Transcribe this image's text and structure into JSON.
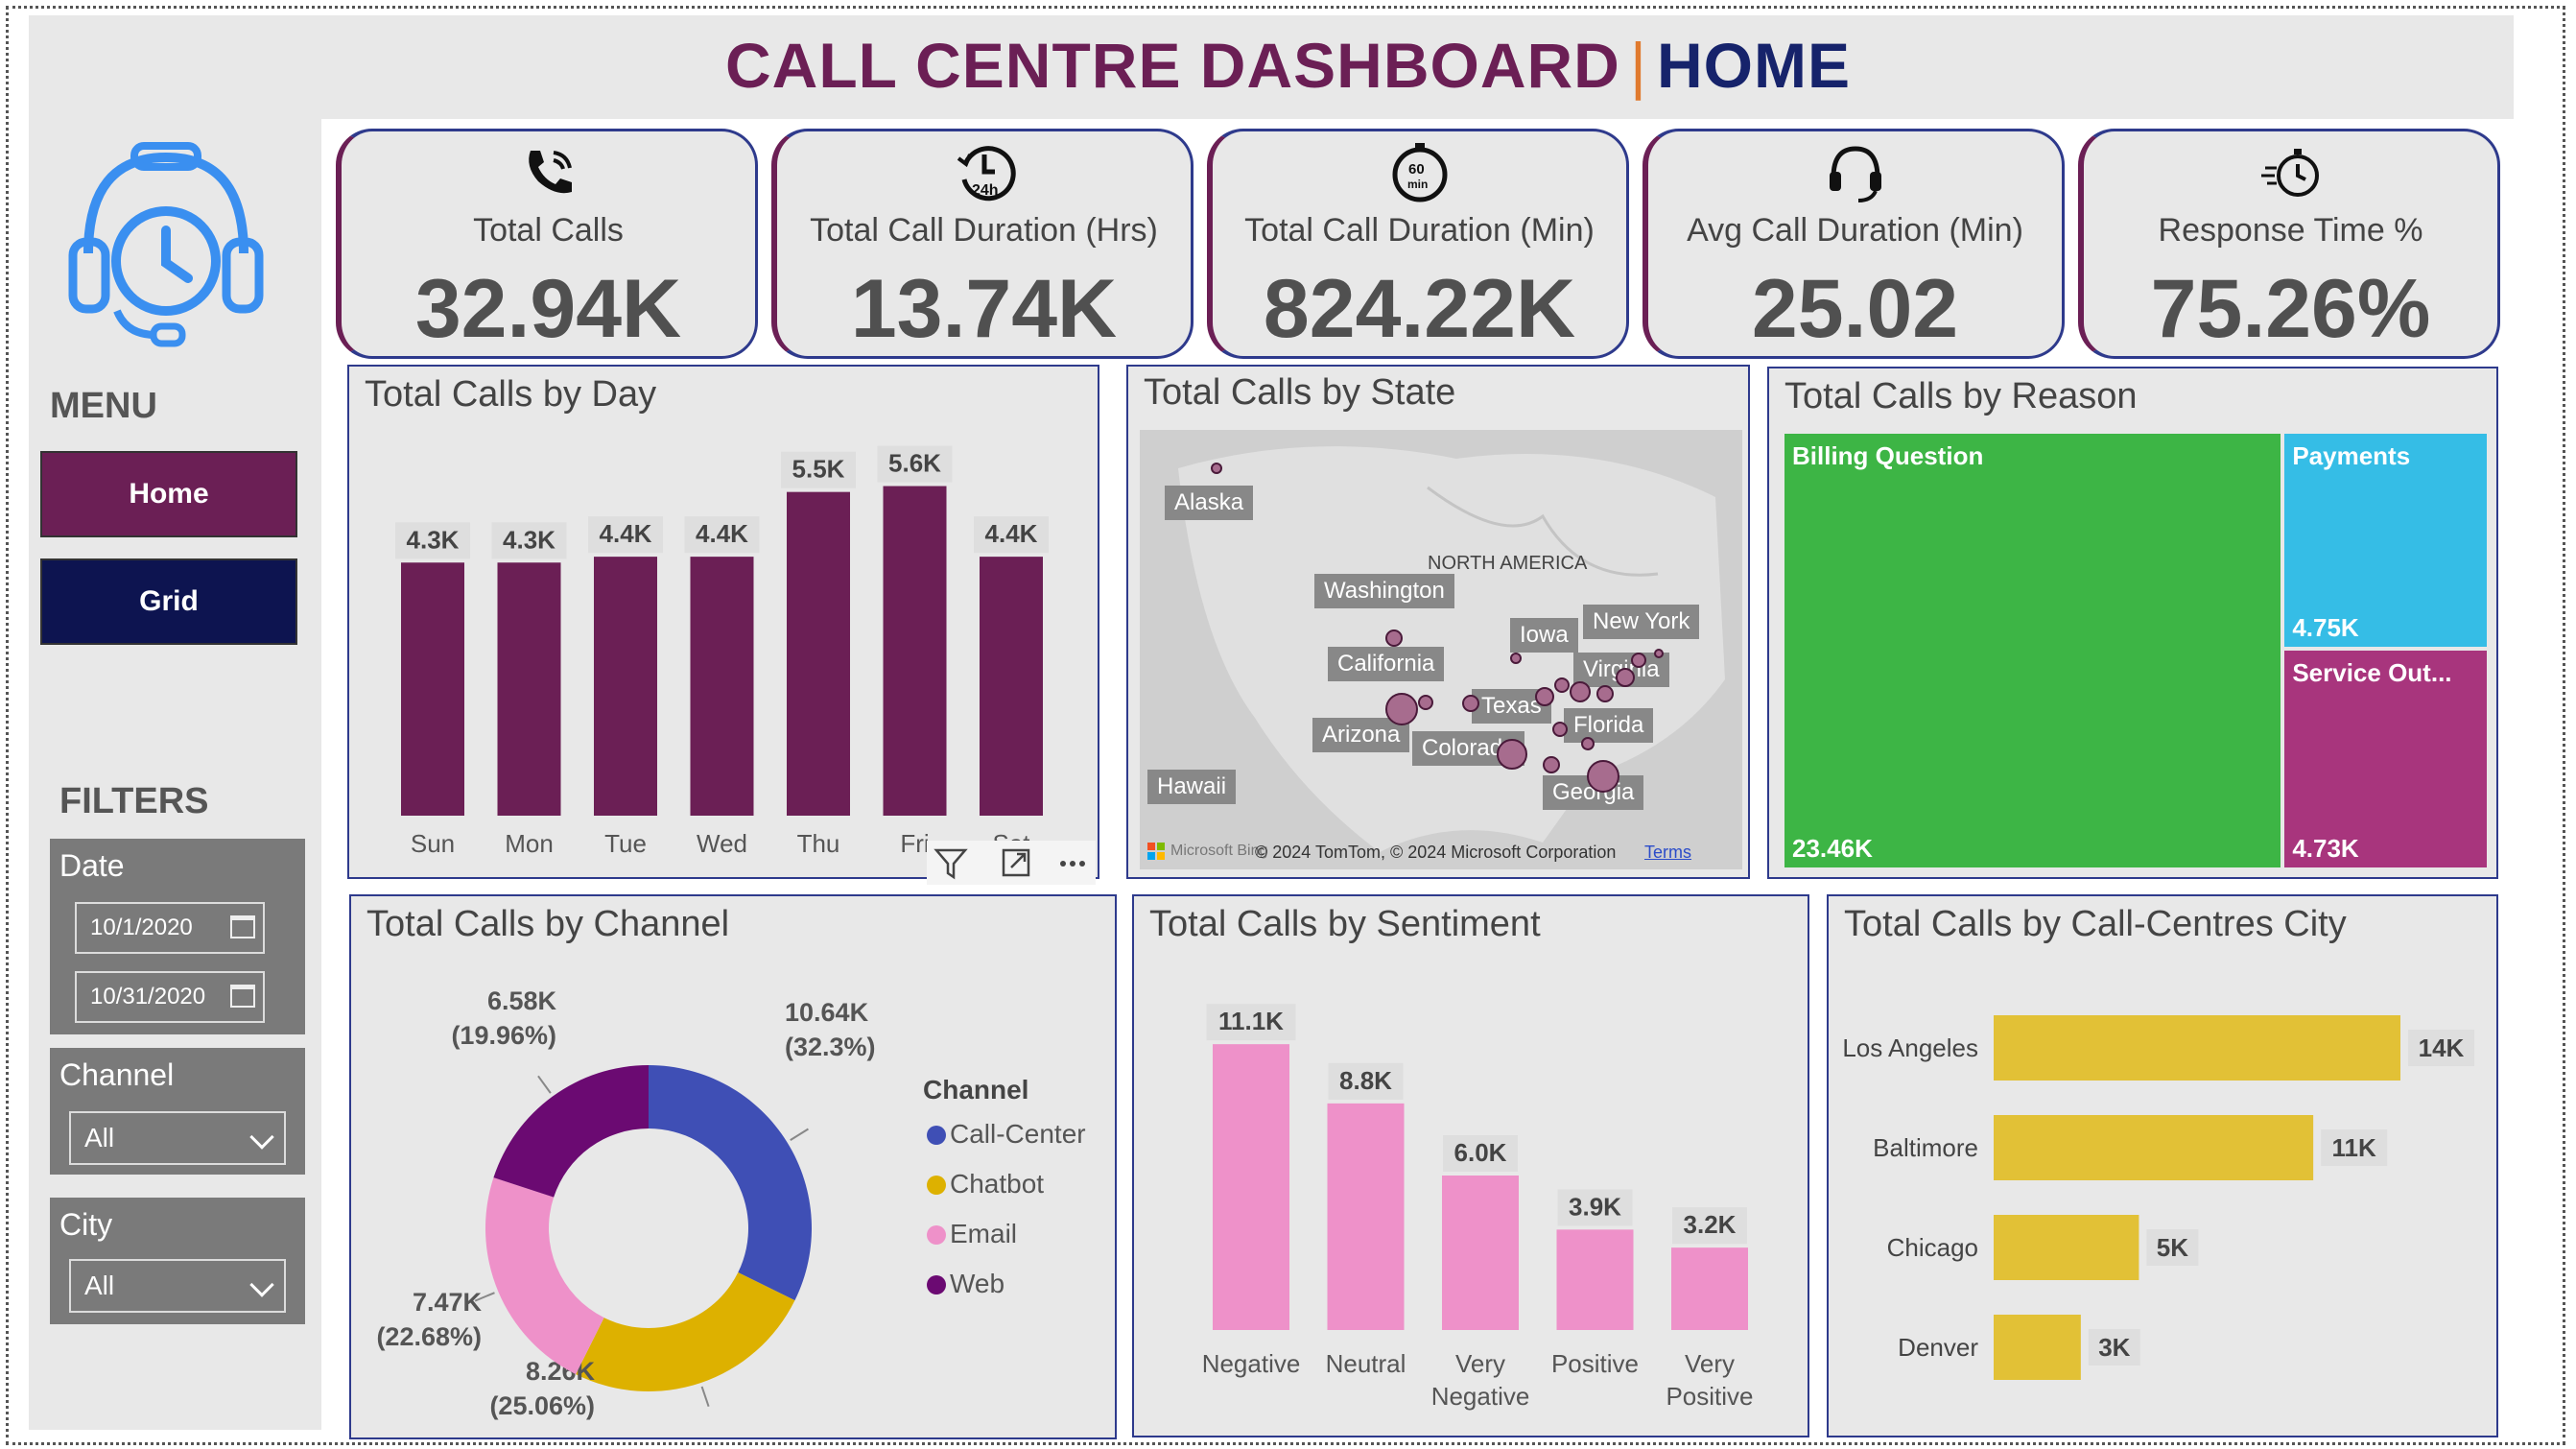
{
  "header": {
    "title_main": "CALL CENTRE DASHBOARD",
    "separator": "|",
    "title_page": "HOME"
  },
  "sidebar": {
    "menu_label": "MENU",
    "nav": [
      {
        "label": "Home"
      },
      {
        "label": "Grid"
      }
    ],
    "filters_label": "FILTERS",
    "date": {
      "label": "Date",
      "start": "10/1/2020",
      "end": "10/31/2020"
    },
    "channel": {
      "label": "Channel",
      "value": "All"
    },
    "city": {
      "label": "City",
      "value": "All"
    }
  },
  "kpis": [
    {
      "icon": "phone-icon",
      "label": "Total Calls",
      "value": "32.94K"
    },
    {
      "icon": "clock-24h-icon",
      "label": "Total Call Duration (Hrs)",
      "value": "13.74K"
    },
    {
      "icon": "timer-60min-icon",
      "label": "Total Call Duration (Min)",
      "value": "824.22K"
    },
    {
      "icon": "headset-icon",
      "label": "Avg Call Duration (Min)",
      "value": "25.02"
    },
    {
      "icon": "stopwatch-icon",
      "label": "Response Time %",
      "value": "75.26%"
    }
  ],
  "visual_header_icons": [
    "filter-icon",
    "focus-mode-icon",
    "more-options-icon"
  ],
  "map": {
    "title": "Total Calls by State",
    "region_label": "NORTH AMERICA",
    "labels": [
      "Alaska",
      "Washington",
      "Iowa",
      "New York",
      "California",
      "Virginia",
      "Texas",
      "Florida",
      "Arizona",
      "Colorado",
      "Hawaii",
      "Georgia"
    ],
    "attribution": "© 2024 TomTom, © 2024 Microsoft Corporation",
    "terms": "Terms",
    "brand": "Microsoft Bing"
  },
  "colors": {
    "plum": "#6b1f55",
    "navy": "#16236b",
    "green": "#3db545",
    "cyan": "#35bde6",
    "magenta": "#a8357d",
    "pink": "#ee91c9",
    "gold": "#e2c136",
    "blue": "#3f4fb5",
    "yellow": "#ddb100",
    "web": "#6b0a72"
  },
  "chart_data": [
    {
      "type": "bar",
      "title": "Total Calls by Day",
      "categories": [
        "Sun",
        "Mon",
        "Tue",
        "Wed",
        "Thu",
        "Fri",
        "Sat"
      ],
      "values": [
        4300,
        4300,
        4400,
        4400,
        5500,
        5600,
        4400
      ],
      "data_labels": [
        "4.3K",
        "4.3K",
        "4.4K",
        "4.4K",
        "5.5K",
        "5.6K",
        "4.4K"
      ],
      "ylim": [
        0,
        6000
      ]
    },
    {
      "type": "treemap",
      "title": "Total Calls by Reason",
      "categories": [
        "Billing Question",
        "Payments",
        "Service Out..."
      ],
      "values": [
        23460,
        4750,
        4730
      ],
      "data_labels": [
        "23.46K",
        "4.75K",
        "4.73K"
      ]
    },
    {
      "type": "pie",
      "title": "Total Calls by Channel",
      "legend_title": "Channel",
      "categories": [
        "Call-Center",
        "Chatbot",
        "Email",
        "Web"
      ],
      "values": [
        10640,
        8260,
        7470,
        6580
      ],
      "data_labels": [
        "10.64K",
        "8.26K",
        "7.47K",
        "6.58K"
      ],
      "percent_labels": [
        "(32.3%)",
        "(25.06%)",
        "(22.68%)",
        "(19.96%)"
      ]
    },
    {
      "type": "bar",
      "title": "Total Calls by Sentiment",
      "categories": [
        "Negative",
        "Neutral",
        "Very Negative",
        "Positive",
        "Very Positive"
      ],
      "values": [
        11100,
        8800,
        6000,
        3900,
        3200
      ],
      "data_labels": [
        "11.1K",
        "8.8K",
        "6.0K",
        "3.9K",
        "3.2K"
      ],
      "ylim": [
        0,
        12000
      ]
    },
    {
      "type": "bar",
      "title": "Total Calls by Call-Centres City",
      "orientation": "horizontal",
      "categories": [
        "Los Angeles",
        "Baltimore",
        "Chicago",
        "Denver"
      ],
      "values": [
        14000,
        11000,
        5000,
        3000
      ],
      "data_labels": [
        "14K",
        "11K",
        "5K",
        "3K"
      ],
      "xlim": [
        0,
        14000
      ]
    }
  ]
}
